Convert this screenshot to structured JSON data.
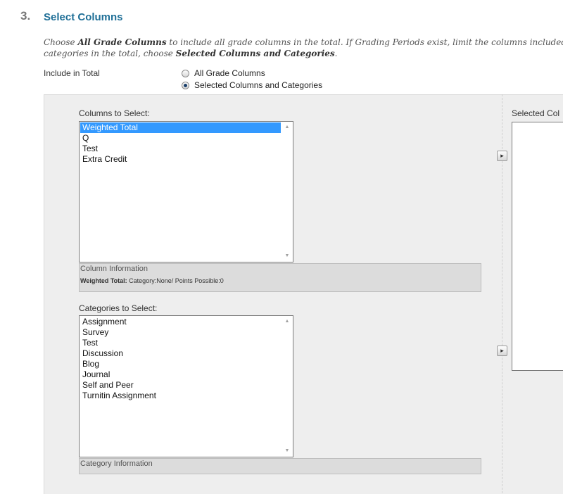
{
  "step": {
    "number": "3.",
    "title": "Select Columns"
  },
  "instructions": {
    "line1_pre": "Choose ",
    "line1_bold": "All Grade Columns",
    "line1_post": " to include all grade columns in the total. If Grading Periods exist, limit the columns included in",
    "line2_pre": "categories in the total, choose ",
    "line2_bold": "Selected Columns and Categories",
    "line2_post": "."
  },
  "include_in_total": {
    "label": "Include in Total",
    "options": [
      {
        "label": "All Grade Columns",
        "checked": false
      },
      {
        "label": "Selected Columns and Categories",
        "checked": true
      }
    ]
  },
  "columns_to_select": {
    "label": "Columns to Select:",
    "items": [
      "Weighted Total",
      "Q",
      "Test",
      "Extra Credit"
    ],
    "selected_index": 0
  },
  "column_information": {
    "title": "Column Information",
    "detail_name": "Weighted Total:",
    "detail_text": " Category:None/ Points Possible:0"
  },
  "categories_to_select": {
    "label": "Categories to Select:",
    "items": [
      "Assignment",
      "Survey",
      "Test",
      "Discussion",
      "Blog",
      "Journal",
      "Self and Peer",
      "Turnitin Assignment"
    ]
  },
  "category_information": {
    "title": "Category Information"
  },
  "selected_columns": {
    "label": "Selected Col"
  },
  "icons": {
    "move_right": "▸",
    "scroll_up": "▲",
    "scroll_down": "▼"
  }
}
